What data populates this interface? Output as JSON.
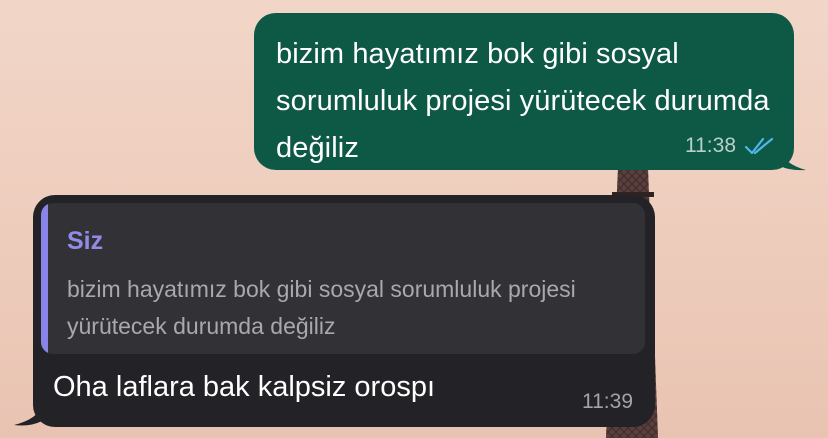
{
  "outgoing_message": {
    "text": "bizim hayatımız bok gibi sosyal sorumluluk projesi yürütecek durumda değiliz",
    "time": "11:38",
    "status_icon": "double-check-read-icon",
    "bubble_color": "#0e5846",
    "tick_color": "#4fb6ec"
  },
  "incoming_message": {
    "quote": {
      "author": "Siz",
      "text": "bizim hayatımız bok gibi sosyal sorumluluk projesi yürütecek durumda değiliz",
      "bar_color": "#8b84e8"
    },
    "text": "Oha laflara bak kalpsiz orospı",
    "time": "11:39",
    "bubble_color": "#232327"
  }
}
